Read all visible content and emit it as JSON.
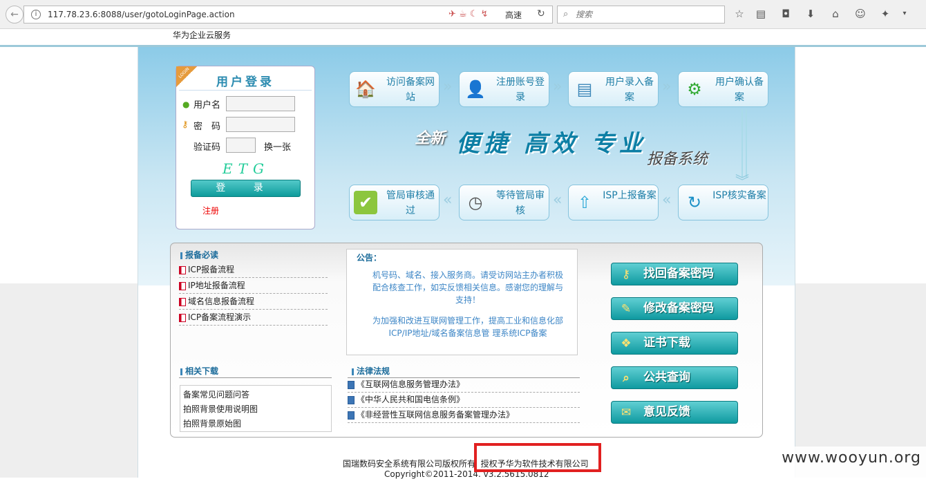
{
  "browser": {
    "url": "117.78.23.6:8088/user/gotoLoginPage.action",
    "speed_label": "高速",
    "search_placeholder": "搜索",
    "bookmark_icons": "☆"
  },
  "site": {
    "brand": "华为企业云服务"
  },
  "login": {
    "ribbon": "LOGIN",
    "title": "用户登录",
    "username_label": "用户名",
    "password_label": "密　码",
    "captcha_label": "验证码",
    "refresh_captcha": "换一张",
    "captcha_text": "ETG",
    "submit": "登  录",
    "register": "注册"
  },
  "flow": {
    "steps": [
      {
        "label": "访问备案网站",
        "icon": "house-icon",
        "glyph": "🏠"
      },
      {
        "label": "注册账号登录",
        "icon": "user-icon",
        "glyph": "👤"
      },
      {
        "label": "用户录入备案",
        "icon": "form-icon",
        "glyph": "▤"
      },
      {
        "label": "用户确认备案",
        "icon": "gear-icon",
        "glyph": "⚙"
      },
      {
        "label": "ISP核实备案",
        "icon": "refresh-icon",
        "glyph": "↻"
      },
      {
        "label": "ISP上报备案",
        "icon": "upload-icon",
        "glyph": "⇧"
      },
      {
        "label": "等待管局审核",
        "icon": "clock-icon",
        "glyph": "◷"
      },
      {
        "label": "管局审核通过",
        "icon": "check-icon",
        "glyph": "✔"
      }
    ],
    "slogan_prefix": "全新",
    "slogan_main": "便捷  高效  专业",
    "slogan_suffix": "报备系统"
  },
  "must_read": {
    "title": "报备必读",
    "items": [
      "ICP报备流程",
      "IP地址报备流程",
      "域名信息报备流程",
      "ICP备案流程演示"
    ]
  },
  "notice": {
    "title": "公告：",
    "p1": "机号码、域名、接入服务商。请受访网站主办者积极配合核查工作，如实反馈相关信息。感谢您的理解与支持！",
    "p2": "为加强和改进互联网管理工作，提高工业和信息化部ICP/IP地址/域名备案信息管 理系统ICP备案"
  },
  "downloads": {
    "title": "相关下载",
    "items": [
      "备案常见问题问答",
      "拍照背景使用说明图",
      "拍照背景原始图"
    ]
  },
  "laws": {
    "title": "法律法规",
    "items": [
      "《互联网信息服务管理办法》",
      "《中华人民共和国电信条例》",
      "《非经营性互联网信息服务备案管理办法》"
    ]
  },
  "actions": [
    {
      "label": "找回备案密码",
      "icon": "key-icon",
      "glyph": "⚷"
    },
    {
      "label": "修改备案密码",
      "icon": "user-edit-icon",
      "glyph": "✎"
    },
    {
      "label": "证书下载",
      "icon": "certificate-icon",
      "glyph": "❖"
    },
    {
      "label": "公共查询",
      "icon": "search-icon",
      "glyph": "⌕"
    },
    {
      "label": "意见反馈",
      "icon": "feedback-icon",
      "glyph": "✉"
    }
  ],
  "footer": {
    "line1_a": "国瑞数码安全系统有限公司版权所有",
    "line1_b": "授权予华为软件技术有限公司",
    "line2": "Copyright©2011-2014.    v3.2.5615.0812"
  },
  "watermark": "www.wooyun.org",
  "colors": {
    "accent": "#0e9b9b",
    "link": "#1e7ea7",
    "highlight": "#e12020"
  }
}
